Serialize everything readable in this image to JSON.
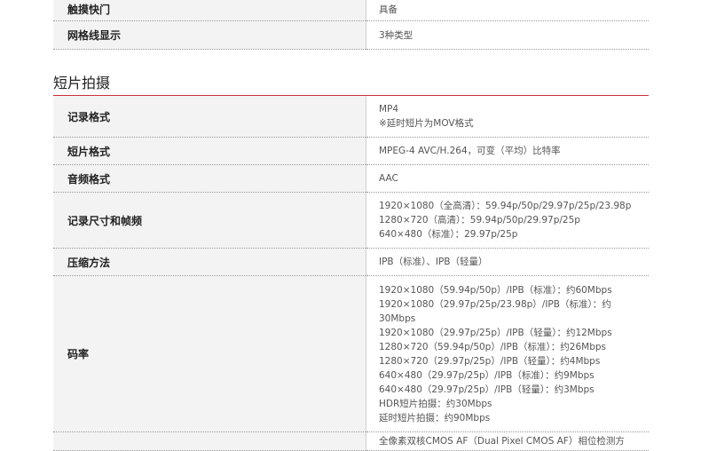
{
  "top_table": [
    {
      "key": "触摸快门",
      "value": "具备"
    },
    {
      "key": "网格线显示",
      "value": "3种类型"
    }
  ],
  "section": {
    "title": "短片拍摄"
  },
  "video_table": [
    {
      "key": "记录格式",
      "lines": [
        "MP4",
        "※延时短片为MOV格式"
      ]
    },
    {
      "key": "短片格式",
      "lines": [
        "MPEG-4 AVC/H.264，可变（平均）比特率"
      ]
    },
    {
      "key": "音频格式",
      "lines": [
        "AAC"
      ]
    },
    {
      "key": "记录尺寸和帧频",
      "lines": [
        "1920×1080（全高清）：59.94p/50p/29.97p/25p/23.98p",
        "1280×720（高清）：59.94p/50p/29.97p/25p",
        "640×480（标准）：29.97p/25p"
      ]
    },
    {
      "key": "压缩方法",
      "lines": [
        "IPB（标准）、IPB（轻量）"
      ]
    },
    {
      "key": "码率",
      "lines": [
        "1920×1080（59.94p/50p）/IPB（标准）：约60Mbps",
        "1920×1080（29.97p/25p/23.98p）/IPB（标准）：约",
        "30Mbps",
        "1920×1080（29.97p/25p）/IPB（轻量）：约12Mbps",
        "1280×720（59.94p/50p）/IPB（标准）：约26Mbps",
        "1280×720（29.97p/25p）/IPB（轻量）：约4Mbps",
        "640×480（29.97p/25p）/IPB（标准）：约9Mbps",
        "640×480（29.97p/25p）/IPB（轻量）：约3Mbps",
        "HDR短片拍摄：约30Mbps",
        "延时短片拍摄：约90Mbps"
      ]
    },
    {
      "key": "",
      "lines": [
        "全像素双核CMOS AF（Dual Pixel CMOS AF）相位检测方"
      ]
    }
  ]
}
